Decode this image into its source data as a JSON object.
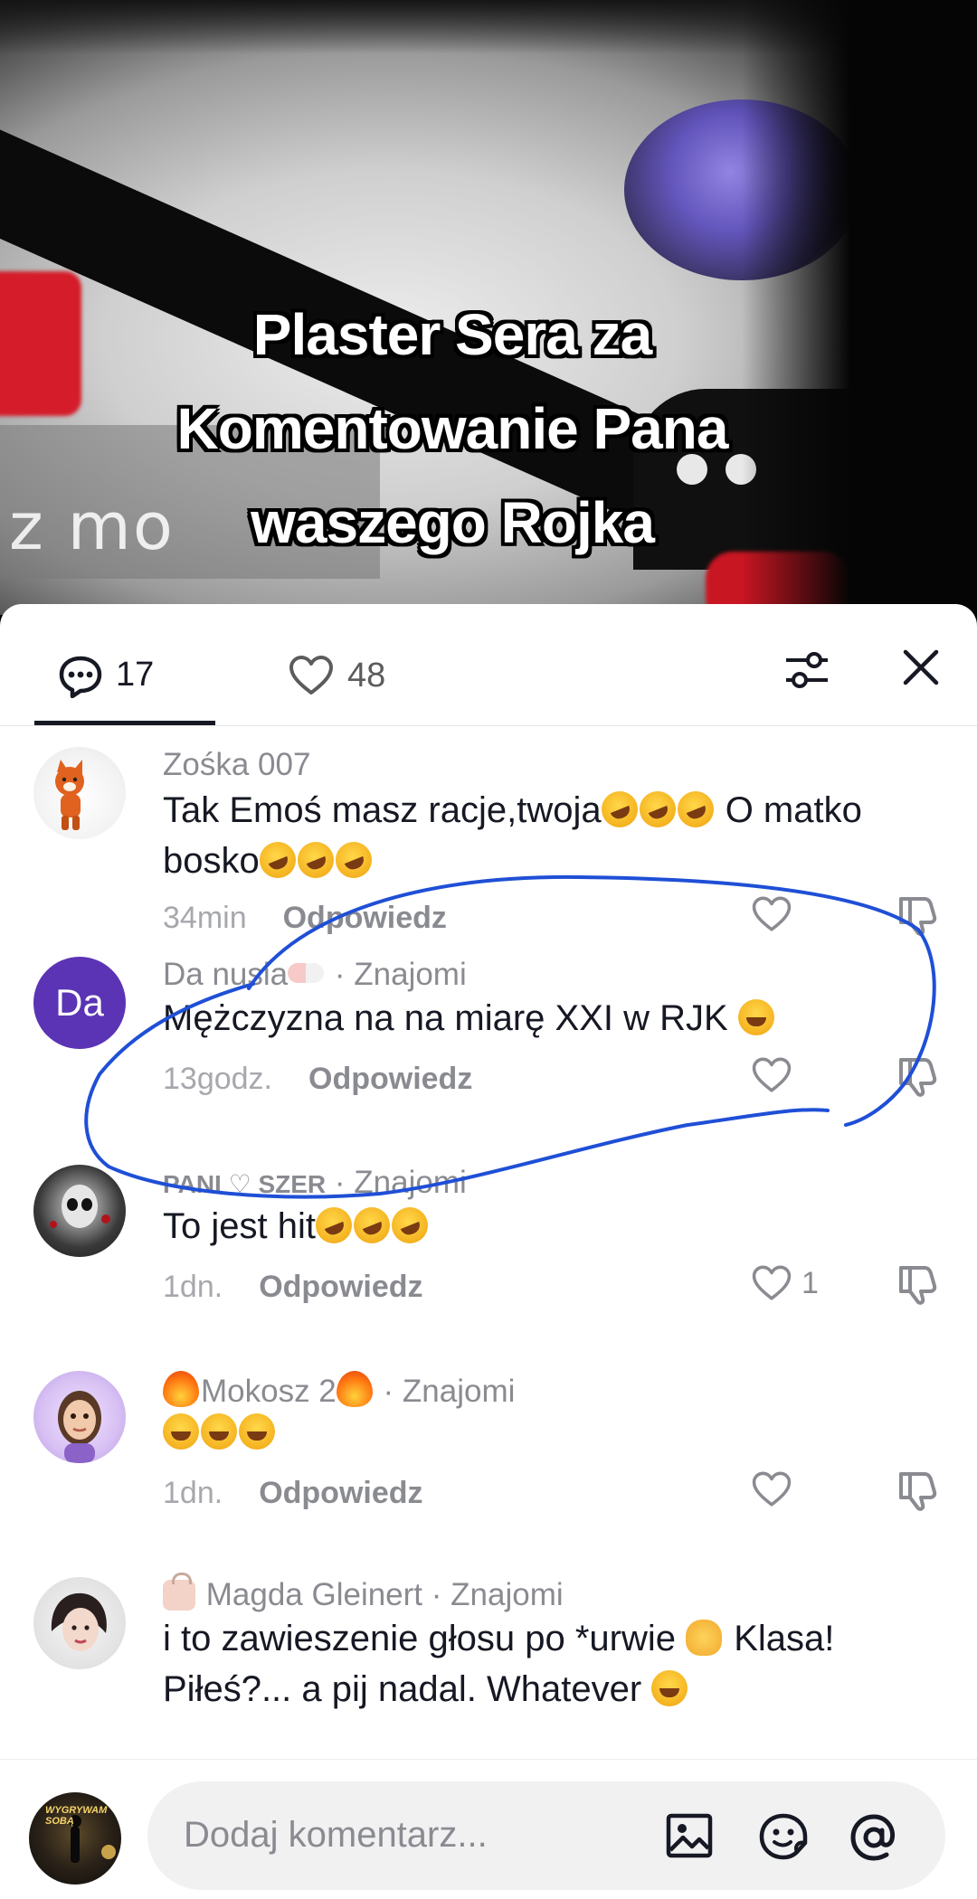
{
  "video": {
    "background_text": "z mo",
    "caption_lines": [
      "Plaster Sera za",
      "Komentowanie Pana",
      "waszego Rojka"
    ]
  },
  "header": {
    "comments_count": "17",
    "likes_count": "48",
    "icons": [
      "comment-bubble-icon",
      "heart-outline-icon",
      "filter-sliders-icon",
      "close-icon"
    ]
  },
  "comments": [
    {
      "author": "Zośka 007",
      "friend_tag": "",
      "text_line1": "Tak Emoś masz racje,twoja",
      "text_after_emoji1": " O matko",
      "text_line2": "bosko",
      "time": "34min",
      "reply_label": "Odpowiedz",
      "likes": ""
    },
    {
      "author": "Da nusia",
      "friend_tag": "· Znajomi",
      "avatar_initials": "Da",
      "text_line1": "Mężczyzna na na miarę XXI w RJK",
      "time": "13godz.",
      "reply_label": "Odpowiedz",
      "likes": ""
    },
    {
      "author": "PANI ♡ SZER",
      "friend_tag": "· Znajomi",
      "text_line1": "To jest hit",
      "time": "1dn.",
      "reply_label": "Odpowiedz",
      "likes": "1"
    },
    {
      "author": "Mokosz 2",
      "friend_tag": "· Znajomi",
      "text_line1": "",
      "time": "1dn.",
      "reply_label": "Odpowiedz",
      "likes": ""
    },
    {
      "author": "Magda Gleinert",
      "friend_tag": "· Znajomi",
      "text_line1": "i to zawieszenie głosu po *urwie",
      "text_after_emoji1": " Klasa!",
      "text_line2": "Piłeś?... a pij nadal. Whatever",
      "time": "",
      "reply_label": "",
      "likes": ""
    }
  ],
  "input_bar": {
    "placeholder": "Dodaj komentarz...",
    "my_avatar_text": "WYGRYWAM SOBĄ",
    "icons": [
      "image-icon",
      "emoji-icon",
      "mention-icon"
    ]
  },
  "colors": {
    "text_primary": "#161823",
    "text_secondary": "#8a8b91",
    "annotation_loop": "#1f4fd6",
    "avatar_da": "#5b33b5"
  }
}
